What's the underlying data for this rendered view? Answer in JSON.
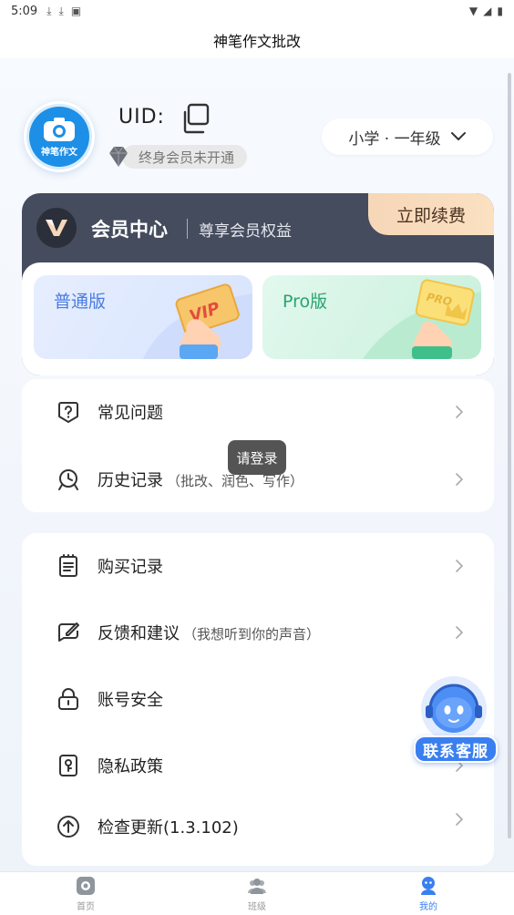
{
  "status_bar": {
    "time": "5:09"
  },
  "header": {
    "title": "神笔作文批改"
  },
  "profile": {
    "avatar_text": "神笔作文",
    "uid_label": "UID:",
    "vip_status": "终身会员未开通",
    "grade": "小学 · 一年级"
  },
  "vip_card": {
    "title": "会员中心",
    "subtitle": "尊享会员权益",
    "renew_label": "立即续费",
    "plans": [
      {
        "label": "普通版"
      },
      {
        "label": "Pro版"
      }
    ]
  },
  "menu_group1": [
    {
      "label": "常见问题",
      "note": "",
      "icon": "question-icon"
    },
    {
      "label": "历史记录",
      "note": "（批改、润色、写作）",
      "icon": "history-icon"
    }
  ],
  "menu_group2": [
    {
      "label": "购买记录",
      "note": "",
      "icon": "receipt-icon"
    },
    {
      "label": "反馈和建议",
      "note": "（我想听到你的声音）",
      "icon": "feedback-icon"
    },
    {
      "label": "账号安全",
      "note": "",
      "icon": "lock-icon"
    },
    {
      "label": "隐私政策",
      "note": "",
      "icon": "privacy-icon"
    },
    {
      "label": "检查更新(1.3.102)",
      "note": "",
      "icon": "update-icon"
    }
  ],
  "toast": {
    "text": "请登录"
  },
  "customer_service": {
    "label": "联系客服"
  },
  "tabbar": {
    "items": [
      {
        "label": "首页",
        "icon": "home-icon",
        "active": false
      },
      {
        "label": "班级",
        "icon": "class-icon",
        "active": false
      },
      {
        "label": "我的",
        "icon": "profile-icon",
        "active": true
      }
    ]
  },
  "colors": {
    "accent": "#3a7ff0",
    "vip_card_bg": "#454c5d",
    "renew_bg": "#f6d7b8",
    "normal_plan": "#4a7ce0",
    "pro_plan": "#2aa46d"
  }
}
